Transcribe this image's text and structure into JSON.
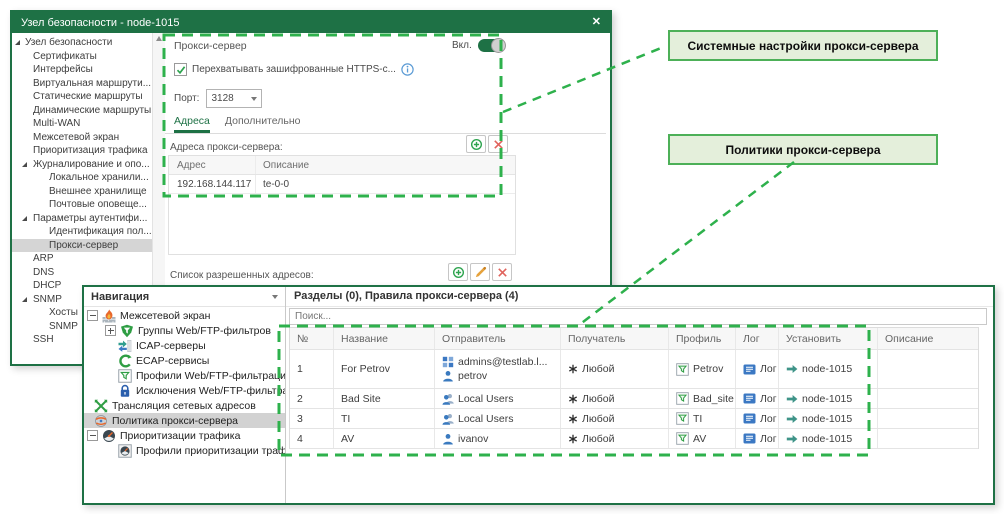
{
  "colors": {
    "window_chrome_green": "#1e7145",
    "annotation_green": "#2eb14c",
    "callout_bg": "#e4efdb",
    "callout_border": "#4db058",
    "selection_gray": "#d5d5d5",
    "accent_blue": "#3a7abf"
  },
  "callouts": [
    "Системные настройки прокси-сервера",
    "Политики прокси-сервера"
  ],
  "node_window": {
    "title": "Узел безопасности - node-1015",
    "close_glyph": "✕",
    "tree": [
      {
        "label": "Узел безопасности"
      },
      {
        "label": "Сертификаты"
      },
      {
        "label": "Интерфейсы"
      },
      {
        "label": "Виртуальная маршрути..."
      },
      {
        "label": "Статические маршруты"
      },
      {
        "label": "Динамические маршруты"
      },
      {
        "label": "Multi-WAN"
      },
      {
        "label": "Межсетевой экран"
      },
      {
        "label": "Приоритизация трафика"
      },
      {
        "label": "Журналирование и опо..."
      },
      {
        "label": "Локальное хранили..."
      },
      {
        "label": "Внешнее хранилище"
      },
      {
        "label": "Почтовые оповеще..."
      },
      {
        "label": "Параметры аутентифи..."
      },
      {
        "label": "Идентификация пол..."
      },
      {
        "label": "Прокси-сервер"
      },
      {
        "label": "ARP"
      },
      {
        "label": "DNS"
      },
      {
        "label": "DHCP"
      },
      {
        "label": "SNMP"
      },
      {
        "label": "Хосты"
      },
      {
        "label": "SNMP"
      },
      {
        "label": "SSH"
      }
    ],
    "panel": {
      "title": "Прокси-сервер",
      "toggle_label": "Вкл.",
      "intercept_checkbox": "Перехватывать зашифрованные HTTPS-с...",
      "port_label": "Порт:",
      "port_value": "3128",
      "tabs": [
        {
          "label": "Адреса"
        },
        {
          "label": "Дополнительно"
        }
      ],
      "addresses_label": "Адреса прокси-сервера:",
      "addresses_table": {
        "headers": [
          "Адрес",
          "Описание"
        ],
        "rows": [
          {
            "address": "192.168.144.117",
            "description": "te-0-0"
          }
        ]
      },
      "allowed_label": "Список разрешенных адресов:"
    }
  },
  "policy_window": {
    "nav_title": "Навигация",
    "nav": [
      {
        "label": "Межсетевой экран"
      },
      {
        "label": "Группы Web/FTP-фильтров"
      },
      {
        "label": "ICAP-серверы"
      },
      {
        "label": "ECAP-сервисы"
      },
      {
        "label": "Профили Web/FTP-фильтрации"
      },
      {
        "label": "Исключения Web/FTP-фильтрации"
      },
      {
        "label": "Трансляция сетевых адресов"
      },
      {
        "label": "Политика прокси-сервера"
      },
      {
        "label": "Приоритизации трафика"
      },
      {
        "label": "Профили приоритизации трафика"
      }
    ],
    "content": {
      "title": "Разделы (0), Правила прокси-сервера (4)",
      "search_placeholder": "Поиск...",
      "columns": [
        "№",
        "Название",
        "Отправитель",
        "Получатель",
        "Профиль",
        "Лог",
        "Установить",
        "Описание"
      ],
      "rows": [
        {
          "num": "1",
          "name": "For Petrov",
          "senders": [
            {
              "text": "admins@testlab.l..."
            },
            {
              "text": "petrov"
            }
          ],
          "recipient": "Любой",
          "profile": "Petrov",
          "log": "Лог",
          "install": "node-1015",
          "description": ""
        },
        {
          "num": "2",
          "name": "Bad Site",
          "senders": [
            {
              "text": "Local Users"
            }
          ],
          "recipient": "Любой",
          "profile": "Bad_site",
          "log": "Лог",
          "install": "node-1015",
          "description": ""
        },
        {
          "num": "3",
          "name": "TI",
          "senders": [
            {
              "text": "Local Users"
            }
          ],
          "recipient": "Любой",
          "profile": "TI",
          "log": "Лог",
          "install": "node-1015",
          "description": ""
        },
        {
          "num": "4",
          "name": "AV",
          "senders": [
            {
              "text": "ivanov"
            }
          ],
          "recipient": "Любой",
          "profile": "AV",
          "log": "Лог",
          "install": "node-1015",
          "description": ""
        }
      ]
    }
  }
}
